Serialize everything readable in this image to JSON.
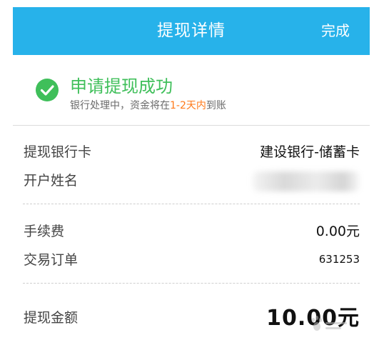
{
  "header": {
    "title": "提现详情",
    "done_label": "完成",
    "bg_color": "#27b2ea"
  },
  "status": {
    "icon": "check-circle-icon",
    "title": "申请提现成功",
    "subtitle_prefix": "银行处理中，资金将在",
    "subtitle_highlight": "1-2天内",
    "subtitle_suffix": "到账",
    "title_color": "#3fbf5a",
    "highlight_color": "#ff7a1a"
  },
  "details": {
    "bank_card_label": "提现银行卡",
    "bank_card_value": "建设银行-储蓄卡",
    "account_name_label": "开户姓名",
    "fee_label": "手续费",
    "fee_value": "0.00元",
    "order_label": "交易订单",
    "order_value": "631253",
    "amount_label": "提现金额",
    "amount_value": "10.00元"
  }
}
